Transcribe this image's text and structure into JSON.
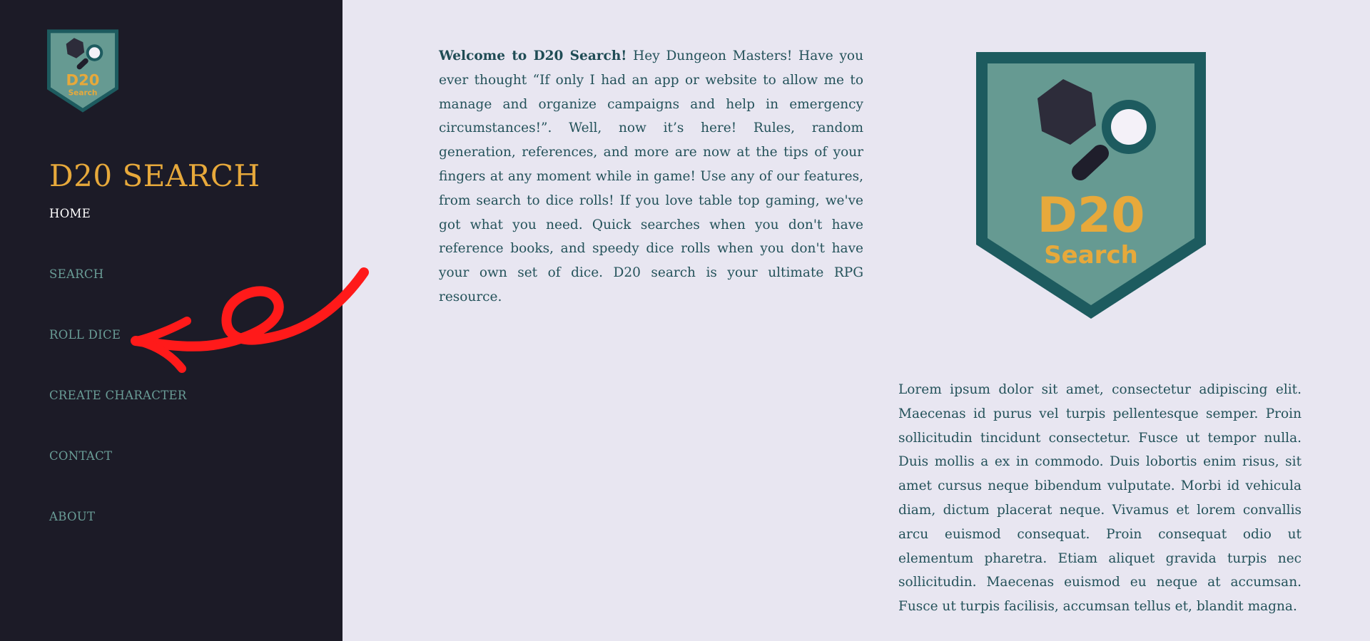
{
  "brand": {
    "title": "D20 SEARCH",
    "logo_text_top": "D20",
    "logo_text_bottom": "Search",
    "colors": {
      "sidebar_bg": "#1c1b27",
      "page_bg": "#e8e6f1",
      "accent_gold": "#e7a93b",
      "logo_dark": "#1d5b5f",
      "logo_mid": "#669a92",
      "nav_text": "#6a9d97",
      "body_text": "#24525a",
      "annotation_red": "#ff1a1a"
    }
  },
  "nav": {
    "items": [
      {
        "label": "HOME",
        "active": true
      },
      {
        "label": "SEARCH",
        "active": false
      },
      {
        "label": "ROLL DICE",
        "active": false
      },
      {
        "label": "CREATE CHARACTER",
        "active": false
      },
      {
        "label": "CONTACT",
        "active": false
      },
      {
        "label": "ABOUT",
        "active": false
      }
    ]
  },
  "main": {
    "intro_bold": "Welcome to D20 Search!",
    "intro_text": " Hey Dungeon Masters! Have you ever thought “If only I had an app or website to allow me to manage and organize campaigns and help in emergency circumstances!”. Well, now it’s here! Rules, random generation, references, and more are now at the tips of your fingers at any moment while in game! Use any of our features, from search to dice rolls! If you love table top gaming, we've got what you need. Quick searches when you don't have reference books, and speedy dice rolls when you don't have your own set of dice. D20 search is your ultimate RPG resource.",
    "lorem": "Lorem ipsum dolor sit amet, consectetur adipiscing elit. Maecenas id purus vel turpis pellentesque semper. Proin sollicitudin tincidunt consectetur. Fusce ut tempor nulla. Duis mollis a ex in commodo. Duis lobortis enim risus, sit amet cursus neque bibendum vulputate. Morbi id vehicula diam, dictum placerat neque. Vivamus et lorem convallis arcu euismod consequat. Proin consequat odio ut elementum pharetra. Etiam aliquet gravida turpis nec sollicitudin. Maecenas euismod eu neque at accumsan. Fusce ut turpis facilisis, accumsan tellus et, blandit magna."
  },
  "icons": {
    "logo": "d20-search-shield-logo",
    "arrow": "red-curved-arrow-annotation"
  }
}
